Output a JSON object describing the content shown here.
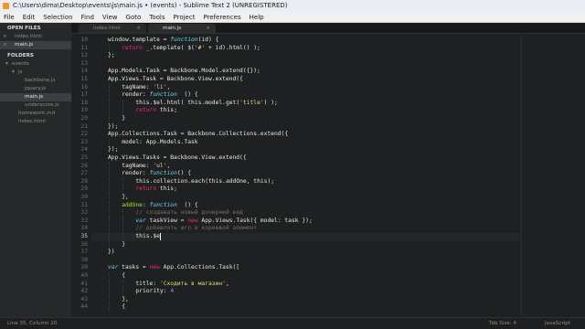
{
  "window": {
    "title": "C:\\Users\\dima\\Desktop\\events\\js\\main.js • (events) - Sublime Text 2 (UNREGISTERED)"
  },
  "menu": [
    "File",
    "Edit",
    "Selection",
    "Find",
    "View",
    "Goto",
    "Tools",
    "Project",
    "Preferences",
    "Help"
  ],
  "sidebar": {
    "open_files_header": "OPEN FILES",
    "open_files": [
      "index.html",
      "main.js"
    ],
    "folders_header": "FOLDERS",
    "tree": [
      {
        "label": "events",
        "type": "folder"
      },
      {
        "label": "js",
        "type": "folder"
      },
      {
        "label": "backbone.js",
        "type": "file"
      },
      {
        "label": "jquery.js",
        "type": "file"
      },
      {
        "label": "main.js",
        "type": "file"
      },
      {
        "label": "underscore.js",
        "type": "file"
      },
      {
        "label": "homework.md",
        "type": "file"
      },
      {
        "label": "index.html",
        "type": "file"
      }
    ]
  },
  "tabs": [
    {
      "label": "index.html",
      "active": false
    },
    {
      "label": "main.js",
      "active": true
    }
  ],
  "editor": {
    "current_line": 35,
    "lines": [
      {
        "n": 10,
        "indent": 1,
        "tokens": [
          [
            "window.template = ",
            ""
          ],
          [
            "function",
            "fn"
          ],
          [
            "(id) {",
            ""
          ]
        ]
      },
      {
        "n": 11,
        "indent": 2,
        "tokens": [
          [
            "return",
            "kw"
          ],
          [
            " _.template( $(",
            ""
          ],
          [
            "'#'",
            "st"
          ],
          [
            " + id).html() );",
            ""
          ]
        ]
      },
      {
        "n": 12,
        "indent": 1,
        "tokens": [
          [
            "};",
            ""
          ]
        ]
      },
      {
        "n": 13,
        "indent": 0,
        "tokens": []
      },
      {
        "n": 14,
        "indent": 1,
        "tokens": [
          [
            "App.Models.Task = Backbone.Model.extend({});",
            ""
          ]
        ]
      },
      {
        "n": 15,
        "indent": 1,
        "tokens": [
          [
            "App.Views.Task = Backbone.View.extend({",
            ""
          ]
        ]
      },
      {
        "n": 16,
        "indent": 2,
        "tokens": [
          [
            "tagName: ",
            ""
          ],
          [
            "'li'",
            "st"
          ],
          [
            ",",
            ""
          ]
        ]
      },
      {
        "n": 17,
        "indent": 2,
        "tokens": [
          [
            "render: ",
            ""
          ],
          [
            "function",
            "fn"
          ],
          [
            "  () {",
            ""
          ]
        ]
      },
      {
        "n": 18,
        "indent": 3,
        "tokens": [
          [
            "this.$el.html( this.model.get(",
            ""
          ],
          [
            "'title'",
            "st"
          ],
          [
            ") );",
            ""
          ]
        ]
      },
      {
        "n": 19,
        "indent": 3,
        "tokens": [
          [
            "return",
            "kw"
          ],
          [
            " this;",
            ""
          ]
        ]
      },
      {
        "n": 20,
        "indent": 2,
        "tokens": [
          [
            "}",
            ""
          ]
        ]
      },
      {
        "n": 21,
        "indent": 1,
        "tokens": [
          [
            "});",
            ""
          ]
        ]
      },
      {
        "n": 22,
        "indent": 1,
        "tokens": [
          [
            "App.Collections.Task = Backbone.Collections.extend({",
            ""
          ]
        ]
      },
      {
        "n": 23,
        "indent": 2,
        "tokens": [
          [
            "model: App.Models.Task",
            ""
          ]
        ]
      },
      {
        "n": 24,
        "indent": 1,
        "tokens": [
          [
            "});",
            ""
          ]
        ]
      },
      {
        "n": 25,
        "indent": 1,
        "tokens": [
          [
            "App.Views.Tasks = Backbone.View.extend({",
            ""
          ]
        ]
      },
      {
        "n": 26,
        "indent": 2,
        "tokens": [
          [
            "tagName: ",
            ""
          ],
          [
            "'ul'",
            "st"
          ],
          [
            ",",
            ""
          ]
        ]
      },
      {
        "n": 27,
        "indent": 2,
        "tokens": [
          [
            "render: ",
            ""
          ],
          [
            "function",
            "fn"
          ],
          [
            "() {",
            ""
          ]
        ]
      },
      {
        "n": 28,
        "indent": 3,
        "tokens": [
          [
            "this.collection.each(this.addOne, this);",
            ""
          ]
        ]
      },
      {
        "n": 29,
        "indent": 3,
        "tokens": [
          [
            "return",
            "kw"
          ],
          [
            " this;",
            ""
          ]
        ]
      },
      {
        "n": 30,
        "indent": 2,
        "tokens": [
          [
            "},",
            ""
          ]
        ]
      },
      {
        "n": 31,
        "indent": 2,
        "tokens": [
          [
            "addOne",
            "fnn"
          ],
          [
            ": ",
            ""
          ],
          [
            "function",
            "fn"
          ],
          [
            "  () {",
            ""
          ]
        ]
      },
      {
        "n": 32,
        "indent": 3,
        "tokens": [
          [
            "// создавать новый дочерний вид",
            "cm"
          ]
        ]
      },
      {
        "n": 33,
        "indent": 3,
        "tokens": [
          [
            "var",
            "fn"
          ],
          [
            " taskView = ",
            ""
          ],
          [
            "new",
            "kw"
          ],
          [
            " App.Views.Task({ model: task });",
            ""
          ]
        ]
      },
      {
        "n": 34,
        "indent": 3,
        "tokens": [
          [
            "// добавлять его в корневой элемент",
            "cm"
          ]
        ]
      },
      {
        "n": 35,
        "indent": 3,
        "tokens": [
          [
            "this.$e",
            ""
          ]
        ]
      },
      {
        "n": 36,
        "indent": 2,
        "tokens": [
          [
            "}",
            ""
          ]
        ]
      },
      {
        "n": 37,
        "indent": 1,
        "tokens": [
          [
            "})",
            ""
          ]
        ]
      },
      {
        "n": 38,
        "indent": 0,
        "tokens": []
      },
      {
        "n": 39,
        "indent": 1,
        "tokens": [
          [
            "var",
            "fn"
          ],
          [
            " tasks = ",
            ""
          ],
          [
            "new",
            "kw"
          ],
          [
            " App.Collections.Task([",
            ""
          ]
        ]
      },
      {
        "n": 40,
        "indent": 2,
        "tokens": [
          [
            "{",
            ""
          ]
        ]
      },
      {
        "n": 41,
        "indent": 3,
        "tokens": [
          [
            "title: ",
            ""
          ],
          [
            "'Сходить в магазин'",
            "st"
          ],
          [
            ",",
            ""
          ]
        ]
      },
      {
        "n": 42,
        "indent": 3,
        "tokens": [
          [
            "priority: ",
            ""
          ],
          [
            "4",
            "nm"
          ]
        ]
      },
      {
        "n": 43,
        "indent": 2,
        "tokens": [
          [
            "},",
            ""
          ]
        ]
      },
      {
        "n": 44,
        "indent": 2,
        "tokens": [
          [
            "{",
            ""
          ]
        ]
      }
    ]
  },
  "status": {
    "position": "Line 35, Column 20",
    "tab_size": "Tab Size: 4",
    "syntax": "JavaScript"
  },
  "colors": {
    "background": "#1e2021",
    "keyword": "#f92672",
    "storage": "#66d9ef",
    "string": "#e6db74",
    "comment": "#75715e",
    "number": "#ae81ff",
    "function_name": "#a6e22e",
    "sublime_icon": "#f7941d"
  }
}
